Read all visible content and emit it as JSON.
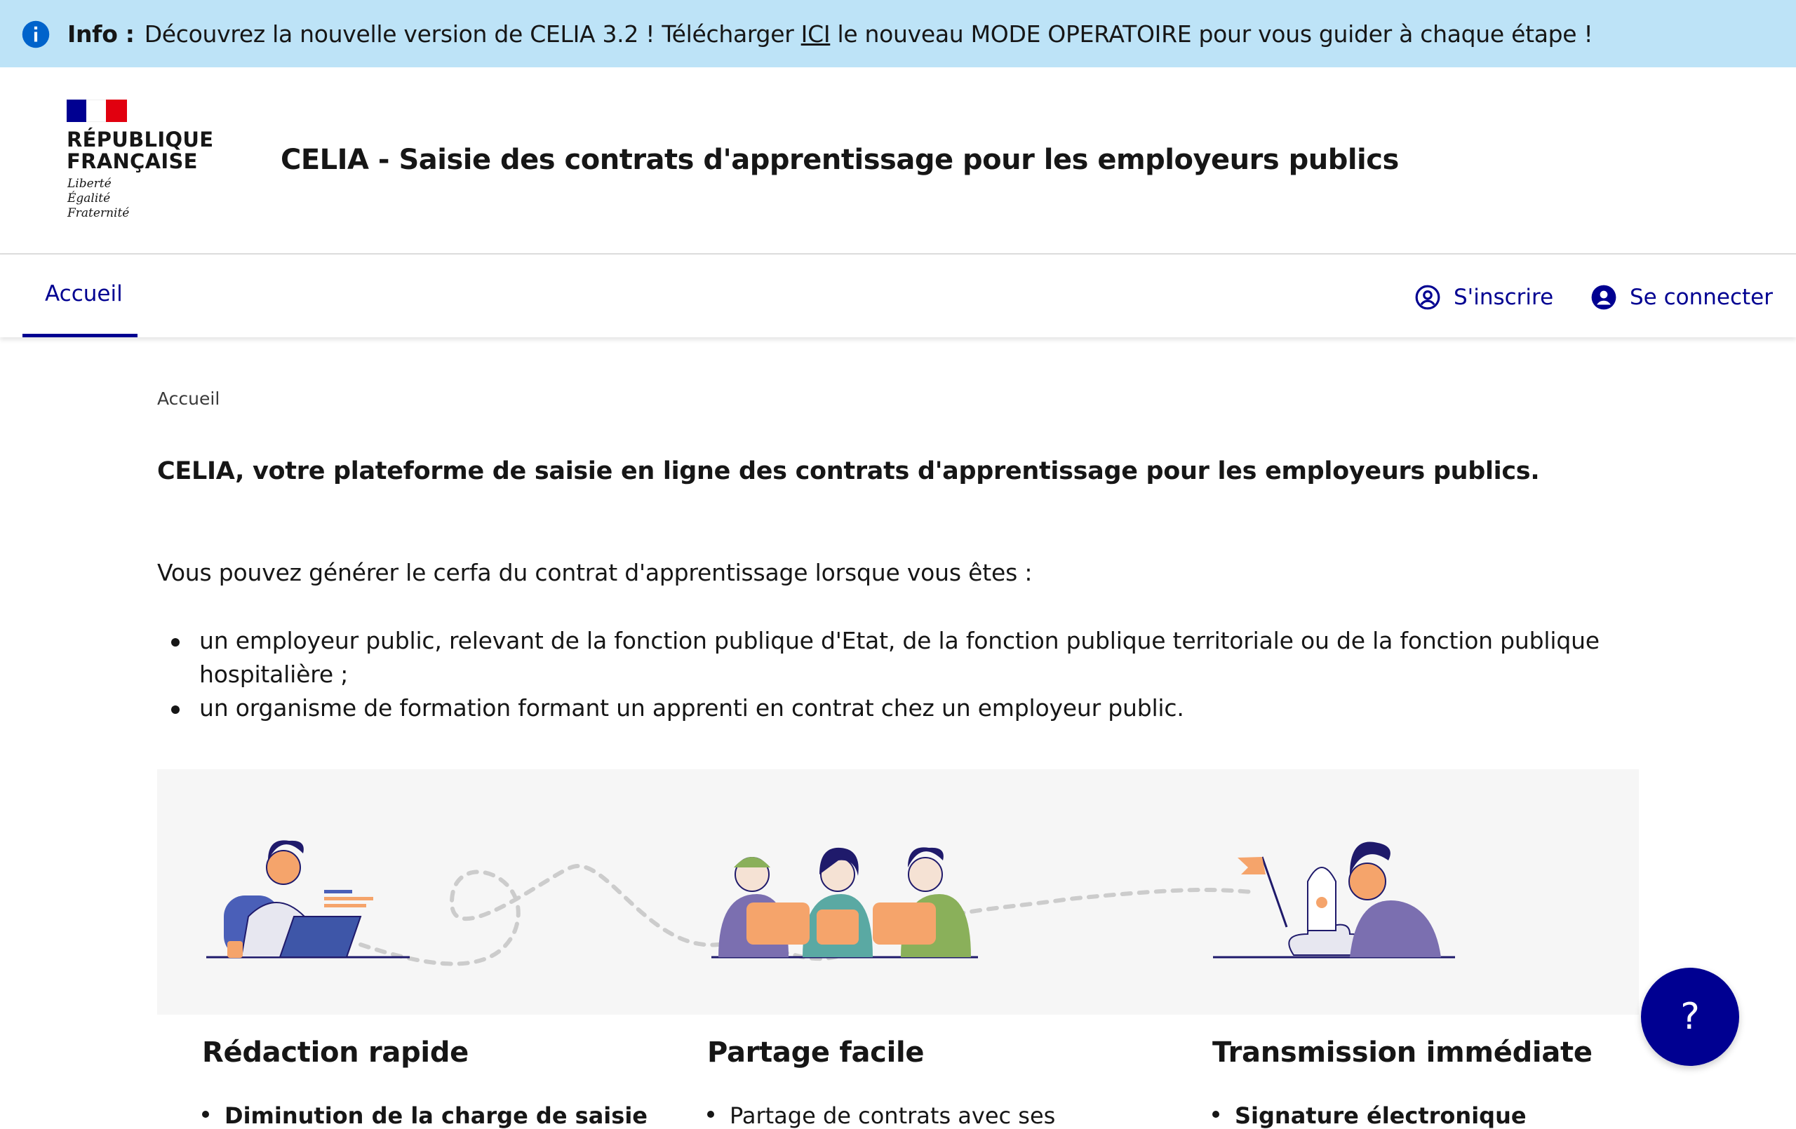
{
  "banner": {
    "label": "Info :",
    "text_before": "Découvrez la nouvelle version de CELIA 3.2 ! Télécharger ",
    "link": "ICI",
    "text_after": " le nouveau MODE OPERATOIRE pour vous guider à chaque étape !",
    "icon": "info-icon"
  },
  "header": {
    "logo_line1": "RÉPUBLIQUE",
    "logo_line2": "FRANÇAISE",
    "motto": [
      "Liberté",
      "Égalité",
      "Fraternité"
    ],
    "site_title": "CELIA - Saisie des contrats d'apprentissage pour les employeurs publics"
  },
  "nav": {
    "home_tab": "Accueil",
    "register": "S'inscrire",
    "login": "Se connecter"
  },
  "breadcrumb": "Accueil",
  "main": {
    "lead": "CELIA, votre plateforme de saisie en ligne des contrats d'apprentissage pour les employeurs publics.",
    "intro": "Vous pouvez générer le cerfa du contrat d'apprentissage lorsque vous êtes :",
    "bullets": [
      "un employeur public, relevant de la fonction publique d'Etat, de la fonction publique territoriale ou de la fonction publique hospitalière ;",
      "un organisme de formation formant un apprenti en contrat chez un employeur public."
    ]
  },
  "features": [
    {
      "title": "Rédaction rapide",
      "item": "Diminution de la charge de saisie"
    },
    {
      "title": "Partage facile",
      "item": "Partage de contrats avec ses"
    },
    {
      "title": "Transmission immédiate",
      "item": "Signature électronique"
    }
  ],
  "help_button": "?",
  "colors": {
    "primary": "#000091",
    "banner_bg": "#bde3f7",
    "info_blue": "#0063cb",
    "illustration_accent": "#f5a46b"
  }
}
